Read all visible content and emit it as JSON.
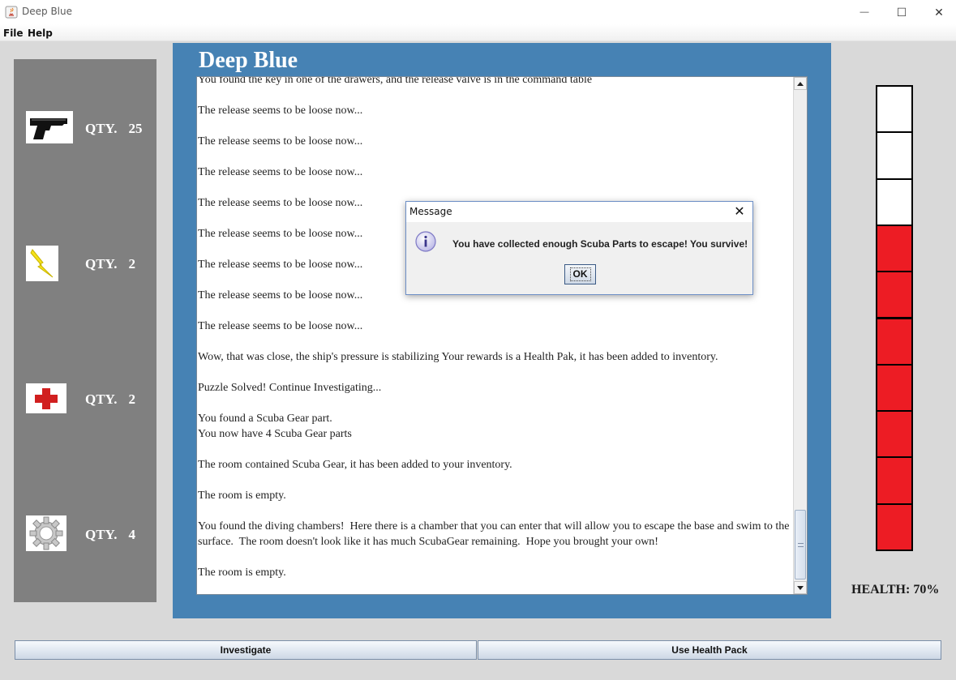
{
  "window": {
    "title": "Deep Blue",
    "controls": {
      "minimize": "—",
      "maximize": "☐",
      "close": "✕"
    }
  },
  "menu": {
    "items": [
      "File",
      "Help"
    ]
  },
  "inventory": {
    "qty_label": "QTY.",
    "items": [
      {
        "icon": "pistol-icon",
        "qty": "25"
      },
      {
        "icon": "lightning-icon",
        "qty": "2"
      },
      {
        "icon": "medical-cross-icon",
        "qty": "2"
      },
      {
        "icon": "gear-icon",
        "qty": "4"
      }
    ]
  },
  "game": {
    "title": "Deep Blue",
    "log": "You found the key in one of the drawers, and the release valve is in the command table\n\nThe release seems to be loose now...\n\nThe release seems to be loose now...\n\nThe release seems to be loose now...\n\nThe release seems to be loose now...\n\nThe release seems to be loose now...\n\nThe release seems to be loose now...\n\nThe release seems to be loose now...\n\nThe release seems to be loose now...\n\nWow, that was close, the ship's pressure is stabilizing Your rewards is a Health Pak, it has been added to inventory.\n\nPuzzle Solved! Continue Investigating...\n\nYou found a Scuba Gear part.\nYou now have 4 Scuba Gear parts\n\nThe room contained Scuba Gear, it has been added to your inventory.\n\nThe room is empty.\n\nYou found the diving chambers!  Here there is a chamber that you can enter that will allow you to escape the base and swim to the surface.  The room doesn't look like it has much ScubaGear remaining.  Hope you brought your own!\n\nThe room is empty."
  },
  "dialog": {
    "title": "Message",
    "close": "✕",
    "message": "You have collected enough Scuba Parts to escape!  You survive!",
    "ok_label": "OK"
  },
  "health": {
    "label": "HEALTH: 70%",
    "percent": 70,
    "segments": 10,
    "filled_color": "#ed1c24",
    "empty_color": "#ffffff"
  },
  "buttons": {
    "investigate": "Investigate",
    "use_health_pack": "Use Health Pack"
  }
}
